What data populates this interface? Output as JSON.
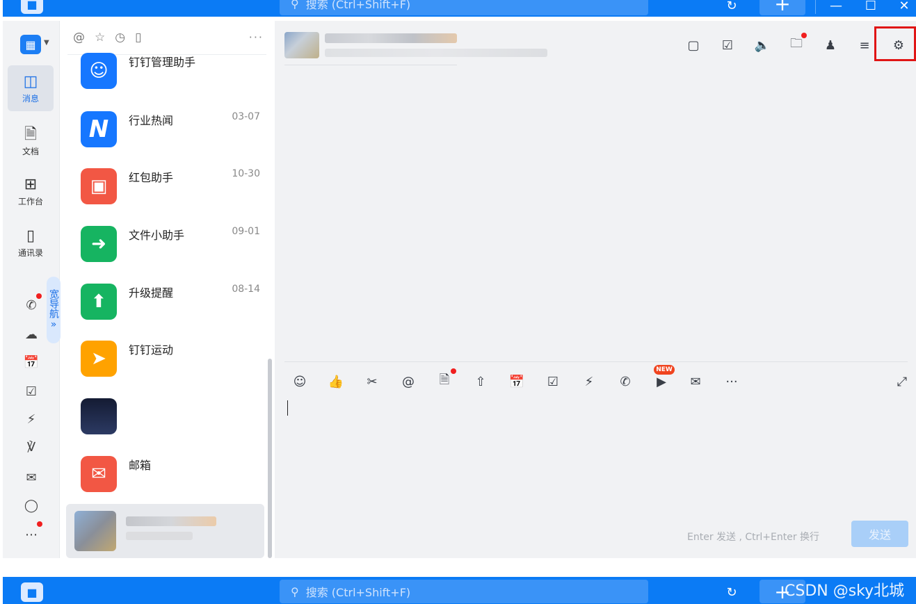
{
  "topbar": {
    "search_placeholder": "搜索 (Ctrl+Shift+F)",
    "history_icon": "history-icon",
    "plus_label": "+",
    "minimize_label": "—",
    "maximize_label": "☐",
    "close_label": "✕"
  },
  "rail": {
    "items": [
      {
        "label": "消息",
        "icon": "message-icon"
      },
      {
        "label": "文档",
        "icon": "document-icon"
      },
      {
        "label": "工作台",
        "icon": "workbench-icon"
      },
      {
        "label": "通讯录",
        "icon": "contacts-icon"
      }
    ],
    "wide_nav_label": "宽导航",
    "wide_nav_chevron": "»"
  },
  "conversations": {
    "items": [
      {
        "name": "钉钉管理助手",
        "date": "",
        "color": "#1677ff"
      },
      {
        "name": "行业热闻",
        "date": "03-07",
        "color": "#1677ff"
      },
      {
        "name": "红包助手",
        "date": "10-30",
        "color": "#f25744"
      },
      {
        "name": "文件小助手",
        "date": "09-01",
        "color": "#16b461"
      },
      {
        "name": "升级提醒",
        "date": "08-14",
        "color": "#16b461"
      },
      {
        "name": "钉钉运动",
        "date": "",
        "color": "#ffa200"
      },
      {
        "name": "",
        "date": "",
        "color": "#1a2340"
      },
      {
        "name": "邮箱",
        "date": "",
        "color": "#f25744"
      }
    ]
  },
  "chat": {
    "new_badge": "NEW",
    "more_label": "···",
    "input_hint": "Enter 发送 , Ctrl+Enter 换行",
    "send_label": "发送"
  },
  "watermark": "CSDN @sky北城",
  "colors": {
    "brand_blue": "#0b7bf5",
    "highlight_red": "#e01515",
    "badge_red": "#f01f1f"
  }
}
